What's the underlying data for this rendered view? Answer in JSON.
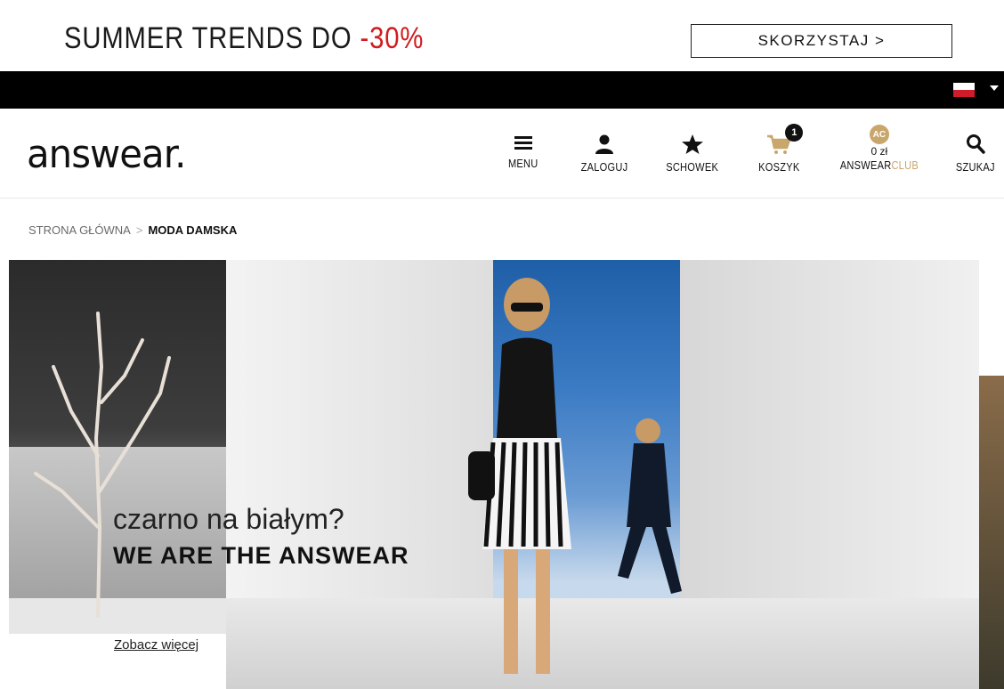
{
  "promo": {
    "text_main": "SUMMER TRENDS DO ",
    "text_discount": "-30%",
    "button_label": "SKORZYSTAJ >",
    "discount_color": "#d01c1f"
  },
  "topbar": {
    "language_flag": "poland-flag-icon"
  },
  "header": {
    "logo": "answear.",
    "nav": [
      {
        "label": "MENU",
        "icon": "hamburger-menu-icon"
      },
      {
        "label": "ZALOGUJ",
        "icon": "user-icon"
      },
      {
        "label": "SCHOWEK",
        "icon": "star-icon"
      },
      {
        "label": "KOSZYK",
        "icon": "cart-icon",
        "badge": "1"
      },
      {
        "label_main": "ANSWEAR",
        "label_accent": "CLUB",
        "icon_text": "AC",
        "amount": "0 zł"
      },
      {
        "label": "SZUKAJ",
        "icon": "search-icon"
      }
    ],
    "accent_color": "#c9a66b"
  },
  "breadcrumb": {
    "home": "STRONA GŁÓWNA",
    "separator": ">",
    "current": "MODA DAMSKA"
  },
  "hero": {
    "line1": "czarno na białym?",
    "line2": "WE ARE THE ANSWEAR",
    "link": "Zobacz więcej"
  }
}
